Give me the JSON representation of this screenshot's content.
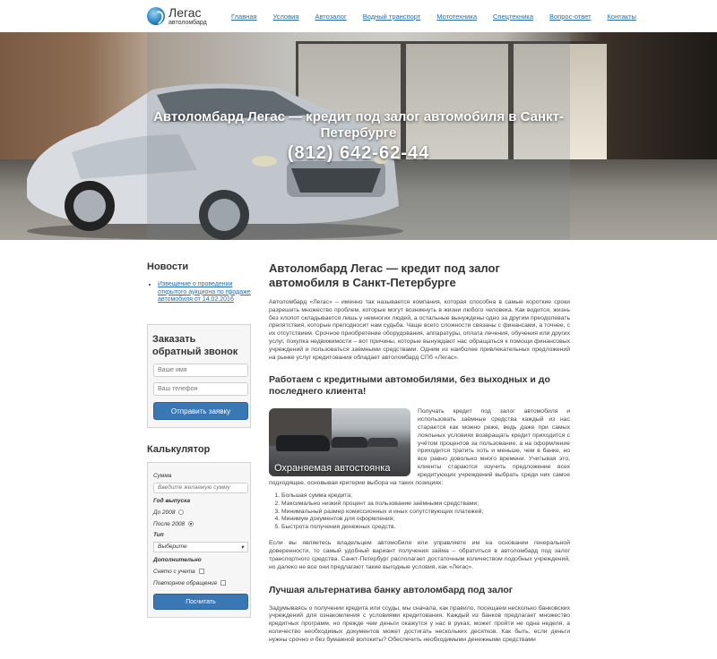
{
  "header": {
    "logo_title": "Легас",
    "logo_sub": "автоломбард",
    "nav": [
      "Главная",
      "Условия",
      "Автозалог",
      "Водный транспорт",
      "Мототехника",
      "Спецтехника",
      "Вопрос-ответ",
      "Контакты"
    ]
  },
  "hero": {
    "title": "Автоломбард Легас — кредит под залог автомобиля в Санкт-Петербурге",
    "phone": "(812) 642-62-44"
  },
  "sidebar": {
    "news_title": "Новости",
    "news_items": [
      "Извещение о проведении открытого аукциона по продаже автомобиля от 14.02.2016"
    ],
    "callback_title": "Заказать обратный звонок",
    "name_placeholder": "Ваше имя",
    "phone_placeholder": "Ваш телефон",
    "submit_label": "Отправить заявку",
    "calc_title": "Калькулятор",
    "calc": {
      "sum_label": "Сумма",
      "sum_placeholder": "Введите желаемую сумму",
      "year_label": "Год выпуска",
      "year_options": [
        "До 2008",
        "После 2008"
      ],
      "year_selected": 1,
      "type_label": "Тип",
      "type_value": "Выберите",
      "extra_label": "Дополнительно",
      "extra_options": [
        "Снято с учета",
        "Повторное обращение"
      ],
      "calc_button": "Посчитать"
    }
  },
  "main": {
    "h1": "Автоломбард Легас — кредит под залог автомобиля в Санкт-Петербурге",
    "p1": "Автоломбард «Легас» – именно так называется компания, которая способна в самые короткие сроки разрешить множество проблем, которые могут возникнуть в жизни любого человека. Как водится, жизнь без хлопот складывается лишь у немногих людей, а остальные вынуждены одно за другим преодолевать препятствия, которые преподносит нам судьба. Чаще всего сложности связаны с финансами, а точнее, с их отсутствием. Срочное приобретение оборудования, аппаратуры, оплата лечения, обучения или других услуг, покупка недвижимости – вот причины, которые вынуждают нас обращаться к помощи финансовых учреждений и пользоваться заёмными средствами. Одним из наиболее привлекательных предложений на рынке услуг кредитования обладает автоломбард СПб «Легас».",
    "h2a": "Работаем с кредитными автомобилями, без выходных и до последнего клиента!",
    "photo_caption": "Охраняемая автостоянка",
    "p2": "Получать кредит под залог автомобиля и использовать заёмные средства каждый из нас старается как можно реже, ведь даже при самых лояльных условиях возвращать кредит приходится с учётом процентов за пользование, а на оформление приходится тратить хоть и меньше, чем в банке, но все равно довольно много времени. Учитывая это, клиенты стараются изучить предложение всех кредитующих учреждений выбрать среди них самое подходящее, основывая критерии выбора на таких позициях:",
    "list": [
      "Большая сумма кредита;",
      "Максимально низкий процент за пользование заёмными средствами;",
      "Минимальный размер комиссионных и иных сопутствующих платежей;",
      "Минимум документов для оформления;",
      "Быстрота получения денежных средств."
    ],
    "p3": "Если вы являетесь владельцем автомобиля или управляете им на основании генеральной доверенности, то самый удобный вариант получения займа – обратиться в автоломбард под залог транспортного средства. Санкт-Петербург располагает достаточным количеством подобных учреждений, но далеко не все они предлагают такие выгодные условия, как «Легас».",
    "h2b": "Лучшая альтернатива банку автоломбард под залог",
    "p4": "Задумываясь о получении кредита или ссуды, мы сначала, как правило, посещаем несколько банковских учреждений для ознакомления с условиями кредитования. Каждый из банков предлагает множество кредитных программ, но прежде чем деньги окажутся у нас в руках, может пройти не одна неделя, а количество необходимых документов может достигать нескольких десятков. Как быть, если деньги нужны срочно и без бумажной волокиты? Обеспечить необходимыми денежными средствами"
  }
}
